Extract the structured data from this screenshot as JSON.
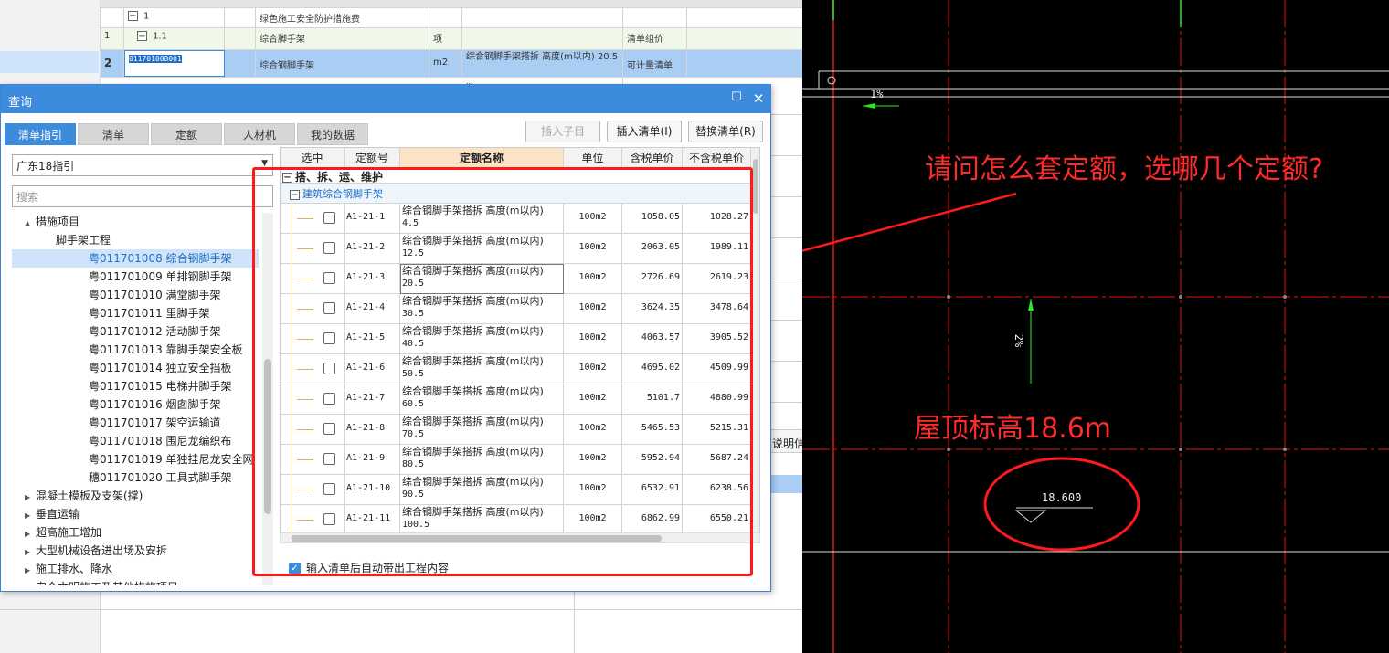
{
  "background_sheet": {
    "rows": [
      {
        "num": "",
        "code": "1",
        "name": "绿色施工安全防护措施费",
        "unit": "",
        "desc": "",
        "type": ""
      },
      {
        "num": "1",
        "code": "1.1",
        "name": "综合脚手架",
        "unit": "项",
        "desc": "",
        "type": "清单组价"
      },
      {
        "num": "2",
        "code": "011701008001",
        "name": "综合钢脚手架",
        "unit": "m2",
        "desc": "综合钢脚手架搭拆 高度(m以内) 20.5",
        "type": "可计量清单"
      },
      {
        "num": "",
        "code": "",
        "name": "",
        "unit": "",
        "desc": "...",
        "type": ""
      }
    ],
    "side_label": "说明信"
  },
  "dialog": {
    "title": "查询",
    "tabs": [
      "清单指引",
      "清单",
      "定额",
      "人材机",
      "我的数据"
    ],
    "active_tab": 0,
    "buttons": {
      "insert_child": "插入子目",
      "insert_list": "插入清单(I)",
      "replace_list": "替换清单(R)"
    },
    "guide_select": "广东18指引",
    "search_placeholder": "搜索",
    "tree": [
      {
        "label": "措施项目",
        "level": 1,
        "arrow": "▲"
      },
      {
        "label": "脚手架工程",
        "level": 2,
        "arrow": ""
      },
      {
        "label": "粤011701008  综合钢脚手架",
        "level": 3,
        "arrow": "",
        "selected": true
      },
      {
        "label": "粤011701009  单排钢脚手架",
        "level": 3,
        "arrow": ""
      },
      {
        "label": "粤011701010  满堂脚手架",
        "level": 3,
        "arrow": ""
      },
      {
        "label": "粤011701011  里脚手架",
        "level": 3,
        "arrow": ""
      },
      {
        "label": "粤011701012  活动脚手架",
        "level": 3,
        "arrow": ""
      },
      {
        "label": "粤011701013  靠脚手架安全板",
        "level": 3,
        "arrow": ""
      },
      {
        "label": "粤011701014  独立安全挡板",
        "level": 3,
        "arrow": ""
      },
      {
        "label": "粤011701015  电梯井脚手架",
        "level": 3,
        "arrow": ""
      },
      {
        "label": "粤011701016  烟囱脚手架",
        "level": 3,
        "arrow": ""
      },
      {
        "label": "粤011701017  架空运输道",
        "level": 3,
        "arrow": ""
      },
      {
        "label": "粤011701018  围尼龙编织布",
        "level": 3,
        "arrow": ""
      },
      {
        "label": "粤011701019  单独挂尼龙安全网",
        "level": 3,
        "arrow": ""
      },
      {
        "label": "穗011701020  工具式脚手架",
        "level": 3,
        "arrow": ""
      },
      {
        "label": "混凝土模板及支架(撑)",
        "level": 1,
        "arrow": "▶"
      },
      {
        "label": "垂直运输",
        "level": 1,
        "arrow": "▶"
      },
      {
        "label": "超高施工增加",
        "level": 1,
        "arrow": "▶"
      },
      {
        "label": "大型机械设备进出场及安拆",
        "level": 1,
        "arrow": "▶"
      },
      {
        "label": "施工排水、降水",
        "level": 1,
        "arrow": "▶"
      },
      {
        "label": "安全文明施工及其他措施项目",
        "level": 1,
        "arrow": "▶"
      }
    ],
    "grid": {
      "headers": [
        "选中",
        "定额号",
        "定额名称",
        "单位",
        "含税单价",
        "不含税单价"
      ],
      "group": "搭、拆、运、维护",
      "subgroup": "建筑综合钢脚手架",
      "rows": [
        {
          "code": "A1-21-1",
          "name": "综合钢脚手架搭拆 高度(m以内)",
          "height": "4.5",
          "unit": "100m2",
          "price_tax": "1058.05",
          "price_notax": "1028.27"
        },
        {
          "code": "A1-21-2",
          "name": "综合钢脚手架搭拆 高度(m以内)",
          "height": "12.5",
          "unit": "100m2",
          "price_tax": "2063.05",
          "price_notax": "1989.11"
        },
        {
          "code": "A1-21-3",
          "name": "综合钢脚手架搭拆 高度(m以内)",
          "height": "20.5",
          "unit": "100m2",
          "price_tax": "2726.69",
          "price_notax": "2619.23"
        },
        {
          "code": "A1-21-4",
          "name": "综合钢脚手架搭拆 高度(m以内)",
          "height": "30.5",
          "unit": "100m2",
          "price_tax": "3624.35",
          "price_notax": "3478.64"
        },
        {
          "code": "A1-21-5",
          "name": "综合钢脚手架搭拆 高度(m以内)",
          "height": "40.5",
          "unit": "100m2",
          "price_tax": "4063.57",
          "price_notax": "3905.52"
        },
        {
          "code": "A1-21-6",
          "name": "综合钢脚手架搭拆 高度(m以内)",
          "height": "50.5",
          "unit": "100m2",
          "price_tax": "4695.02",
          "price_notax": "4509.99"
        },
        {
          "code": "A1-21-7",
          "name": "综合钢脚手架搭拆 高度(m以内)",
          "height": "60.5",
          "unit": "100m2",
          "price_tax": "5101.7",
          "price_notax": "4880.99"
        },
        {
          "code": "A1-21-8",
          "name": "综合钢脚手架搭拆 高度(m以内)",
          "height": "70.5",
          "unit": "100m2",
          "price_tax": "5465.53",
          "price_notax": "5215.31"
        },
        {
          "code": "A1-21-9",
          "name": "综合钢脚手架搭拆 高度(m以内)",
          "height": "80.5",
          "unit": "100m2",
          "price_tax": "5952.94",
          "price_notax": "5687.24"
        },
        {
          "code": "A1-21-10",
          "name": "综合钢脚手架搭拆 高度(m以内)",
          "height": "90.5",
          "unit": "100m2",
          "price_tax": "6532.91",
          "price_notax": "6238.56"
        },
        {
          "code": "A1-21-11",
          "name": "综合钢脚手架搭拆 高度(m以内)",
          "height": "100.5",
          "unit": "100m2",
          "price_tax": "6862.99",
          "price_notax": "6550.21"
        }
      ]
    },
    "auto_checkbox_label": "输入清单后自动带出工程内容"
  },
  "annotations": {
    "question": "请问怎么套定额，选哪几个定额?",
    "roof_height": "屋顶标高18.6m",
    "color": "#ff1a1a"
  },
  "cad": {
    "slope_top": "1%",
    "slope_mid": "2%",
    "elevation": "18.600"
  }
}
